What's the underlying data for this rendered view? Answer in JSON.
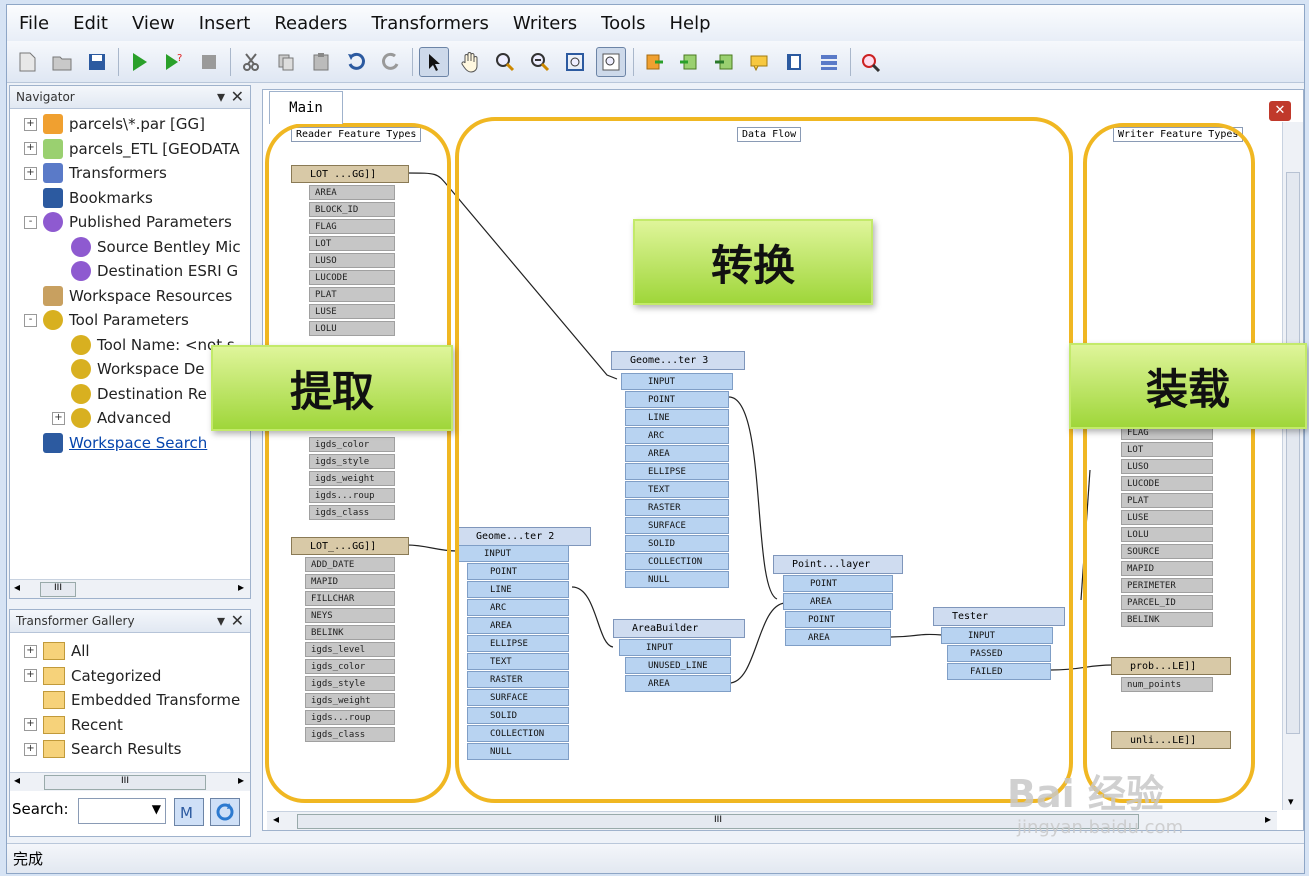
{
  "menubar": [
    "File",
    "Edit",
    "View",
    "Insert",
    "Readers",
    "Transformers",
    "Writers",
    "Tools",
    "Help"
  ],
  "navigator": {
    "title": "Navigator",
    "items": [
      {
        "label": "parcels\\*.par [GG]",
        "exp": "+"
      },
      {
        "label": "parcels_ETL [GEODATA",
        "exp": "+"
      },
      {
        "label": "Transformers",
        "exp": "+"
      },
      {
        "label": "Bookmarks",
        "exp": ""
      },
      {
        "label": "Published Parameters",
        "exp": "-"
      },
      {
        "label": "Source Bentley Mic",
        "exp": ""
      },
      {
        "label": "Destination ESRI G",
        "exp": ""
      },
      {
        "label": "Workspace Resources",
        "exp": ""
      },
      {
        "label": "Tool Parameters",
        "exp": "-"
      },
      {
        "label": "Tool Name: <not s",
        "exp": ""
      },
      {
        "label": "Workspace De",
        "exp": ""
      },
      {
        "label": "Destination Re",
        "exp": ""
      },
      {
        "label": "Advanced",
        "exp": "+"
      },
      {
        "label": "Workspace Search",
        "exp": ""
      }
    ]
  },
  "gallery": {
    "title": "Transformer Gallery",
    "items": [
      "All",
      "Categorized",
      "Embedded Transforme",
      "Recent",
      "Search Results"
    ],
    "search_label": "Search:"
  },
  "canvas": {
    "tab": "Main",
    "bookmarks": [
      "Reader Feature Types",
      "Data Flow",
      "Writer Feature Types"
    ],
    "reader1": {
      "head": "LOT ...GG]]",
      "attrs": [
        "AREA",
        "BLOCK_ID",
        "FLAG",
        "LOT",
        "LUSO",
        "LUCODE",
        "PLAT",
        "LUSE",
        "LOLU"
      ]
    },
    "reader1_lower": [
      "igds_color",
      "igds_style",
      "igds_weight",
      "igds...roup",
      "igds_class"
    ],
    "reader2": {
      "head": "LOT_...GG]]",
      "attrs": [
        "ADD_DATE",
        "MAPID",
        "FILLCHAR",
        "NEYS",
        "BELINK",
        "igds_level",
        "igds_color",
        "igds_style",
        "igds_weight",
        "igds...roup",
        "igds_class"
      ]
    },
    "geom3": {
      "head": "Geome...ter 3",
      "ports": [
        "INPUT",
        "POINT",
        "LINE",
        "ARC",
        "AREA",
        "ELLIPSE",
        "TEXT",
        "RASTER",
        "SURFACE",
        "SOLID",
        "COLLECTION",
        "NULL"
      ]
    },
    "geom2": {
      "head": "Geome...ter 2",
      "ports": [
        "INPUT",
        "POINT",
        "LINE",
        "ARC",
        "AREA",
        "ELLIPSE",
        "TEXT",
        "RASTER",
        "SURFACE",
        "SOLID",
        "COLLECTION",
        "NULL"
      ]
    },
    "areabuilder": {
      "head": "AreaBuilder",
      "ports": [
        "INPUT",
        "UNUSED_LINE",
        "AREA"
      ]
    },
    "pip": {
      "head": "Point...layer",
      "ports": [
        "POINT",
        "AREA",
        "POINT",
        "AREA"
      ]
    },
    "tester": {
      "head": "Tester",
      "ports": [
        "INPUT",
        "PASSED",
        "FAILED"
      ]
    },
    "writer_attrs": [
      "FLAG",
      "LOT",
      "LUSO",
      "LUCODE",
      "PLAT",
      "LUSE",
      "LOLU",
      "SOURCE",
      "MAPID",
      "PERIMETER",
      "PARCEL_ID",
      "BELINK"
    ],
    "prob": {
      "head": "prob...LE]]",
      "attr": "num_points"
    },
    "writer3": {
      "head": "unli...LE]]"
    }
  },
  "overlays": {
    "extract": "提取",
    "transform": "转换",
    "load": "装载"
  },
  "status": "完成",
  "watermark": {
    "logo": "Bai 经验",
    "url": "jingyan.baidu.com"
  },
  "colors": {
    "orange": "#f0b722",
    "green": "#9fd63a"
  }
}
